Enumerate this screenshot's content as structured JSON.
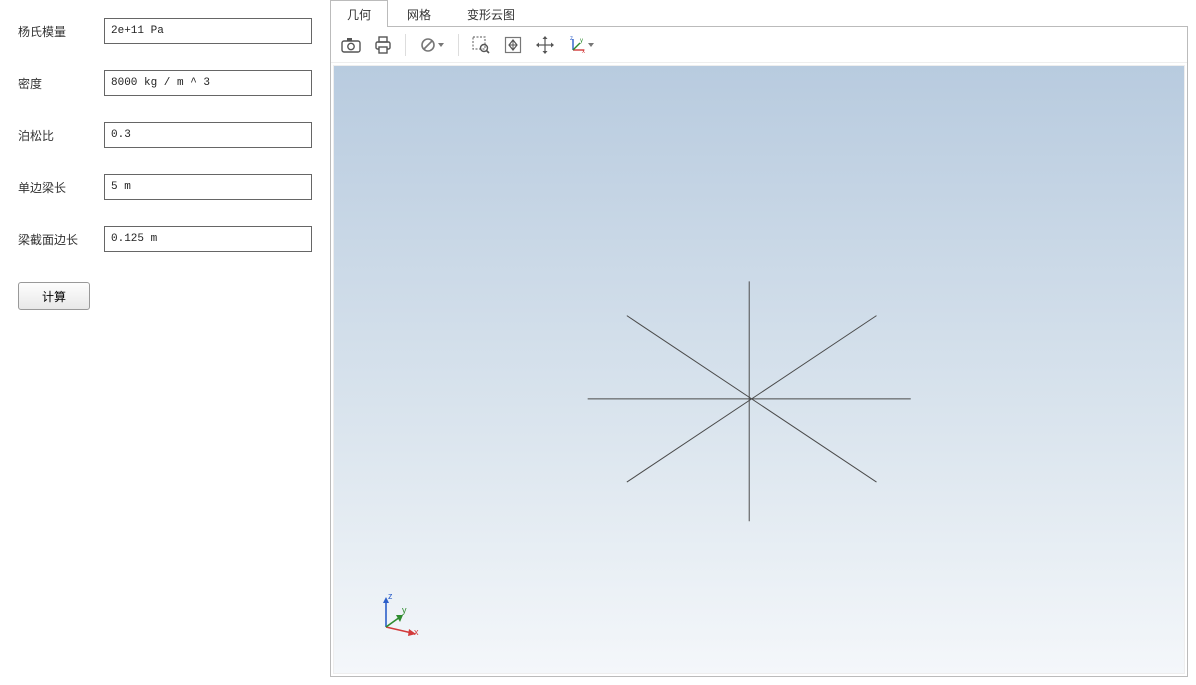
{
  "form": {
    "youngs_modulus": {
      "label": "杨氏模量",
      "value": "2e+11 Pa"
    },
    "density": {
      "label": "密度",
      "value": "8000 kg / m ^ 3"
    },
    "poisson": {
      "label": "泊松比",
      "value": "0.3"
    },
    "beam_length": {
      "label": "单边梁长",
      "value": "5 m"
    },
    "section_side": {
      "label": "梁截面边长",
      "value": "0.125 m"
    },
    "calculate_label": "计算"
  },
  "tabs": [
    {
      "label": "几何",
      "active": true
    },
    {
      "label": "网格",
      "active": false
    },
    {
      "label": "变形云图",
      "active": false
    }
  ],
  "toolbar": {
    "camera": "camera-icon",
    "print": "print-icon",
    "reset": "reset-view-icon",
    "zoom_box": "zoom-box-icon",
    "fit": "fit-view-icon",
    "pan": "pan-icon",
    "axis": "axis-orientation-icon"
  },
  "axis_gizmo": {
    "x": "x",
    "y": "y",
    "z": "z"
  },
  "colors": {
    "line": "#4a4a4a",
    "x_axis": "#d23a3a",
    "y_axis": "#2e8b2e",
    "z_axis": "#2c5fc9"
  }
}
